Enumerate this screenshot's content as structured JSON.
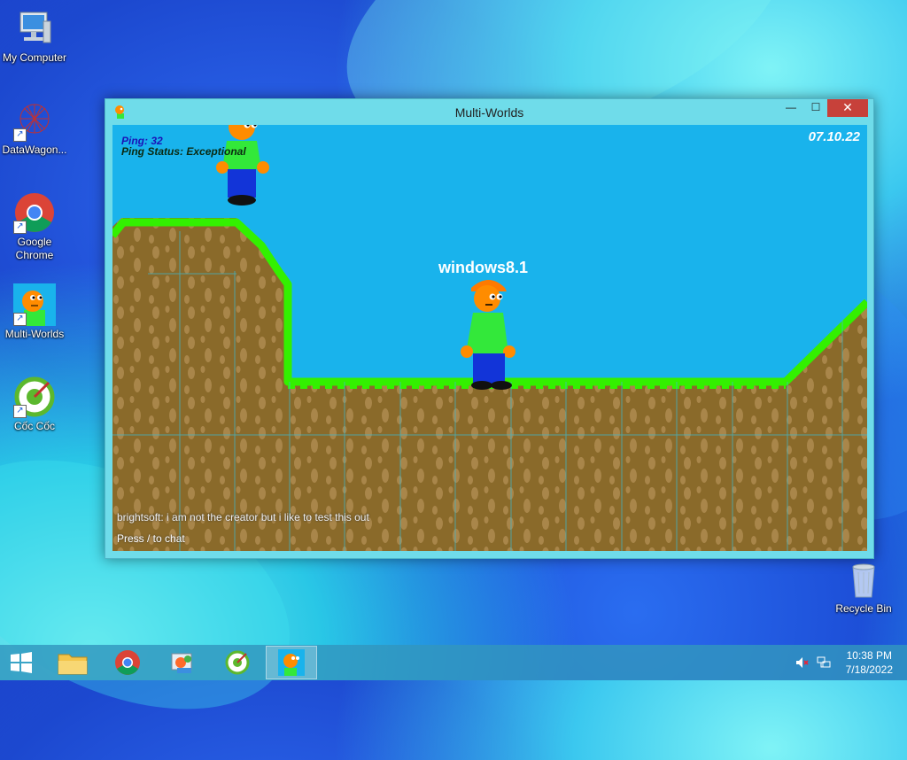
{
  "desktop": {
    "icons": [
      {
        "label": "My Computer"
      },
      {
        "label": "DataWagon..."
      },
      {
        "label": "Google Chrome"
      },
      {
        "label": "Multi-Worlds"
      },
      {
        "label": "Cốc Cốc"
      },
      {
        "label": "Recycle Bin"
      }
    ]
  },
  "window": {
    "title": "Multi-Worlds",
    "controls": {
      "minimize": "—",
      "maximize": "☐",
      "close": "✕"
    }
  },
  "game": {
    "ping": "Ping: 32",
    "ping_status": "Ping Status: Exceptional",
    "date": "07.10.22",
    "player_name": "windows8.1",
    "chat_message": "brightsoft: i am not the creator but i like to test this out",
    "chat_hint": "Press / to chat"
  },
  "taskbar": {
    "time": "10:38 PM",
    "date": "7/18/2022"
  },
  "colors": {
    "sky": "#19b3ec",
    "grass": "#33f000",
    "dirt": "#8a6a2a",
    "shirt": "#33e83a",
    "pants": "#1234d8",
    "skin": "#ff8c00",
    "close_button": "#c7413a"
  }
}
